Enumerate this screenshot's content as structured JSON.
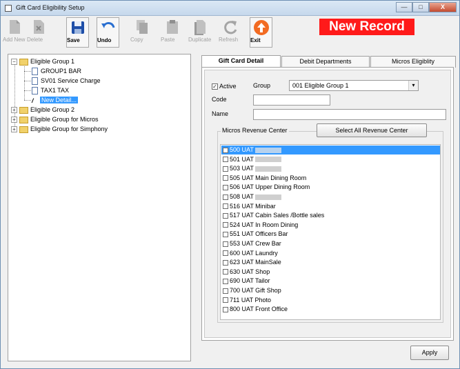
{
  "window": {
    "title": "Gift Card Eligibility Setup",
    "buttons": [
      "—",
      "□",
      "X"
    ]
  },
  "toolbar": {
    "buttons": [
      {
        "label": "Add New",
        "enabled": false,
        "icon": "add-new-icon"
      },
      {
        "label": "Delete",
        "enabled": false,
        "icon": "delete-icon"
      },
      {
        "label": "Save",
        "enabled": true,
        "icon": "save-icon"
      },
      {
        "label": "Undo",
        "enabled": true,
        "icon": "undo-icon"
      },
      {
        "label": "Copy",
        "enabled": false,
        "icon": "copy-icon"
      },
      {
        "label": "Paste",
        "enabled": false,
        "icon": "paste-icon"
      },
      {
        "label": "Duplicate",
        "enabled": false,
        "icon": "duplicate-icon"
      },
      {
        "label": "Refresh",
        "enabled": false,
        "icon": "refresh-icon"
      },
      {
        "label": "Exit",
        "enabled": true,
        "icon": "exit-icon"
      }
    ]
  },
  "banner": {
    "text": "New Record",
    "color": "#ff1a1a"
  },
  "tree": {
    "root": "Eligible Group 1",
    "children": [
      "GROUP1 BAR",
      "SV01 Service Charge",
      "TAX1 TAX",
      "New Detail..."
    ],
    "groups": [
      "Eligible Group 2",
      "Eligible Group for Micros",
      "Eligible Group for Simphony"
    ],
    "expand_minus": "−",
    "expand_plus": "+"
  },
  "tabs": [
    "Gift Card Detail",
    "Debit Departments",
    "Micros Eligiblity"
  ],
  "detail": {
    "active_label": "Active",
    "active_checked": true,
    "group_label": "Group",
    "group_value": "001    Eligible Group 1",
    "code_label": "Code",
    "code_value": "",
    "name_label": "Name",
    "name_value": "",
    "revenue_group_title": "Micros Revenue Center",
    "select_all_label": "Select All Revenue Center"
  },
  "revenue_centers": [
    {
      "text": "500 UAT",
      "redacted": true,
      "selected": true
    },
    {
      "text": "501 UAT",
      "redacted": true,
      "selected": false
    },
    {
      "text": "503 UAT",
      "redacted": true,
      "selected": false
    },
    {
      "text": "505 UAT Main Dining Room",
      "redacted": false,
      "selected": false
    },
    {
      "text": "506 UAT Upper Dining Room",
      "redacted": false,
      "selected": false
    },
    {
      "text": "508 UAT",
      "redacted": true,
      "selected": false
    },
    {
      "text": "516 UAT Minibar",
      "redacted": false,
      "selected": false
    },
    {
      "text": "517 UAT Cabin Sales /Bottle sales",
      "redacted": false,
      "selected": false
    },
    {
      "text": "524 UAT In Room Dining",
      "redacted": false,
      "selected": false
    },
    {
      "text": "551 UAT Officers Bar",
      "redacted": false,
      "selected": false
    },
    {
      "text": "553 UAT Crew Bar",
      "redacted": false,
      "selected": false
    },
    {
      "text": "600 UAT Laundry",
      "redacted": false,
      "selected": false
    },
    {
      "text": "623 UAT MainSale",
      "redacted": false,
      "selected": false
    },
    {
      "text": "630 UAT Shop",
      "redacted": false,
      "selected": false
    },
    {
      "text": "690 UAT Tailor",
      "redacted": false,
      "selected": false
    },
    {
      "text": "700 UAT Gift Shop",
      "redacted": false,
      "selected": false
    },
    {
      "text": "711 UAT Photo",
      "redacted": false,
      "selected": false
    },
    {
      "text": "800 UAT Front Office",
      "redacted": false,
      "selected": false
    }
  ],
  "footer": {
    "apply_label": "Apply"
  },
  "misc": {
    "combo_arrow": "▾"
  }
}
